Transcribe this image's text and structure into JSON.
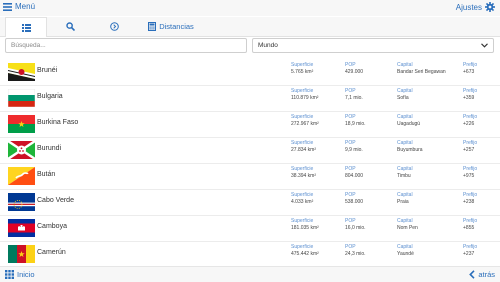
{
  "header": {
    "menu_label": "Menú",
    "settings_label": "Ajustes"
  },
  "tabs": {
    "distances_label": "Distancias"
  },
  "filters": {
    "search_placeholder": "Búsqueda...",
    "region_value": "Mundo"
  },
  "column_labels": {
    "area": "Superficie",
    "population": "POP",
    "capital": "Capital",
    "prefix": "Prefijo"
  },
  "countries": [
    {
      "name": "Brunéi",
      "area": "5.765 km²",
      "population": "429.000",
      "capital": "Bandar Seri Begawan",
      "prefix": "+673"
    },
    {
      "name": "Bulgaria",
      "area": "110.879 km²",
      "population": "7,1 mio.",
      "capital": "Sofía",
      "prefix": "+359"
    },
    {
      "name": "Burkina Faso",
      "area": "272.967 km²",
      "population": "18,9 mio.",
      "capital": "Uagadugú",
      "prefix": "+226"
    },
    {
      "name": "Burundi",
      "area": "27.834 km²",
      "population": "9,9 mio.",
      "capital": "Buyumbura",
      "prefix": "+257"
    },
    {
      "name": "Bután",
      "area": "38.394 km²",
      "population": "804.000",
      "capital": "Timbu",
      "prefix": "+975"
    },
    {
      "name": "Cabo Verde",
      "area": "4.033 km²",
      "population": "538.000",
      "capital": "Praia",
      "prefix": "+238"
    },
    {
      "name": "Camboya",
      "area": "181.035 km²",
      "population": "16,0 mio.",
      "capital": "Nom Pen",
      "prefix": "+855"
    },
    {
      "name": "Camerún",
      "area": "475.442 km²",
      "population": "24,3 mio.",
      "capital": "Yaundé",
      "prefix": "+237"
    }
  ],
  "footer": {
    "home_label": "Inicio",
    "back_label": "atrás"
  },
  "colors": {
    "accent": "#2a6ebb",
    "bar_background": "#f7f7f7"
  }
}
